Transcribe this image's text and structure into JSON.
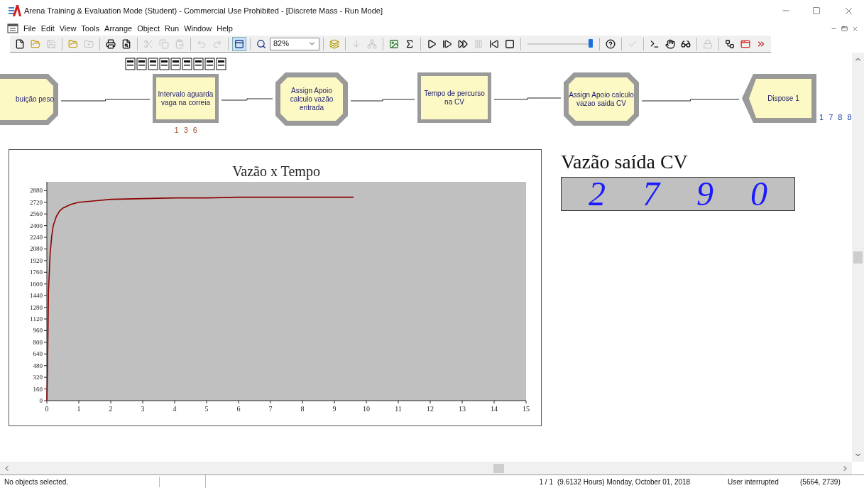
{
  "window": {
    "title": "Arena Training & Evaluation Mode (Student) - Commercial Use Prohibited - [Discrete Mass - Run Mode]"
  },
  "menu": [
    "File",
    "Edit",
    "View",
    "Tools",
    "Arrange",
    "Object",
    "Run",
    "Window",
    "Help"
  ],
  "toolbar": [
    {
      "kind": "button",
      "disabled": false,
      "pressed": false
    },
    {
      "kind": "button",
      "disabled": false,
      "pressed": false
    },
    {
      "kind": "button",
      "disabled": true,
      "pressed": false
    },
    {
      "kind": "separator"
    },
    {
      "kind": "button",
      "disabled": false,
      "pressed": false
    },
    {
      "kind": "button",
      "disabled": true,
      "pressed": false
    },
    {
      "kind": "separator"
    },
    {
      "kind": "button",
      "disabled": false,
      "pressed": false
    },
    {
      "kind": "button",
      "disabled": false,
      "pressed": false
    },
    {
      "kind": "separator"
    },
    {
      "kind": "button",
      "disabled": true,
      "pressed": false
    },
    {
      "kind": "button",
      "disabled": true,
      "pressed": false
    },
    {
      "kind": "button",
      "disabled": true,
      "pressed": false
    },
    {
      "kind": "separator"
    },
    {
      "kind": "button",
      "disabled": true,
      "pressed": false
    },
    {
      "kind": "button",
      "disabled": true,
      "pressed": false
    },
    {
      "kind": "separator"
    },
    {
      "kind": "button",
      "disabled": false,
      "pressed": true
    },
    {
      "kind": "separator"
    },
    {
      "kind": "button",
      "disabled": false,
      "pressed": false
    },
    {
      "kind": "zoom",
      "value": "82%"
    },
    {
      "kind": "separator"
    },
    {
      "kind": "button",
      "disabled": false,
      "pressed": false
    },
    {
      "kind": "separator"
    },
    {
      "kind": "button",
      "disabled": true,
      "pressed": false
    },
    {
      "kind": "button",
      "disabled": true,
      "pressed": false
    },
    {
      "kind": "separator"
    },
    {
      "kind": "button",
      "disabled": false,
      "pressed": false
    },
    {
      "kind": "button",
      "disabled": false,
      "pressed": false
    },
    {
      "kind": "separator"
    },
    {
      "kind": "button",
      "disabled": false,
      "pressed": false
    },
    {
      "kind": "button",
      "disabled": false,
      "pressed": false
    },
    {
      "kind": "button",
      "disabled": false,
      "pressed": false
    },
    {
      "kind": "button",
      "disabled": true,
      "pressed": false
    },
    {
      "kind": "button",
      "disabled": false,
      "pressed": false
    },
    {
      "kind": "button",
      "disabled": false,
      "pressed": false
    },
    {
      "kind": "separator"
    },
    {
      "kind": "slider",
      "level": 0.93
    },
    {
      "kind": "separator"
    },
    {
      "kind": "button",
      "disabled": false,
      "pressed": false
    },
    {
      "kind": "separator"
    },
    {
      "kind": "button",
      "disabled": true,
      "pressed": false
    },
    {
      "kind": "separator"
    },
    {
      "kind": "button",
      "disabled": false,
      "pressed": false
    },
    {
      "kind": "button",
      "disabled": false,
      "pressed": false
    },
    {
      "kind": "button",
      "disabled": false,
      "pressed": false
    },
    {
      "kind": "separator"
    },
    {
      "kind": "button",
      "disabled": true,
      "pressed": false
    },
    {
      "kind": "separator"
    },
    {
      "kind": "button",
      "disabled": false,
      "pressed": false
    },
    {
      "kind": "button",
      "disabled": false,
      "pressed": false
    },
    {
      "kind": "button",
      "disabled": false,
      "pressed": false
    }
  ],
  "modules": [
    {
      "kind": "assign",
      "label": "buição peso"
    },
    {
      "kind": "process",
      "label": "Intervalo aguarda vaga na correia",
      "counter": "1 3 6",
      "queue": true
    },
    {
      "kind": "assign",
      "label": "Assign Apoio calculo vazão entrada"
    },
    {
      "kind": "process",
      "label": "Tempo de percurso na CV"
    },
    {
      "kind": "assign",
      "label": "Assign Apoio calculo vazao saida CV"
    },
    {
      "kind": "dispose",
      "label": "Dispose 1",
      "counter": "1 7 8 8"
    }
  ],
  "plot": {
    "chart_data": {
      "type": "line",
      "title": "Vazão x Tempo",
      "x": [
        0,
        0.02,
        0.05,
        0.1,
        0.15,
        0.2,
        0.3,
        0.4,
        0.5,
        0.75,
        1,
        1.5,
        2,
        3,
        4,
        5,
        6,
        7,
        8,
        9,
        9.6
      ],
      "series": [
        {
          "color": "#8b0000",
          "values": [
            0,
            400,
            1500,
            2000,
            2250,
            2400,
            2530,
            2600,
            2640,
            2690,
            2720,
            2740,
            2760,
            2770,
            2780,
            2780,
            2790,
            2790,
            2790,
            2790,
            2790
          ]
        }
      ],
      "xlim": [
        0,
        15
      ],
      "ylim": [
        0,
        3000
      ],
      "xticks": [
        0,
        1,
        2,
        3,
        4,
        5,
        6,
        7,
        8,
        9,
        10,
        11,
        12,
        13,
        14,
        15
      ],
      "yticks": [
        0,
        160,
        320,
        480,
        640,
        800,
        960,
        1120,
        1280,
        1440,
        1600,
        1760,
        1920,
        2080,
        2240,
        2400,
        2560,
        2720,
        2880
      ]
    }
  },
  "display": {
    "title": "Vazão saída CV",
    "digits": [
      "2",
      "7",
      "9",
      "0"
    ]
  },
  "status_bar": {
    "message": "No objects selected.",
    "page": "1 / 1",
    "time": "(9.6132 Hours) Monday, October 01, 2018",
    "state": "User interrupted",
    "coords": "(5664, 2739)"
  }
}
